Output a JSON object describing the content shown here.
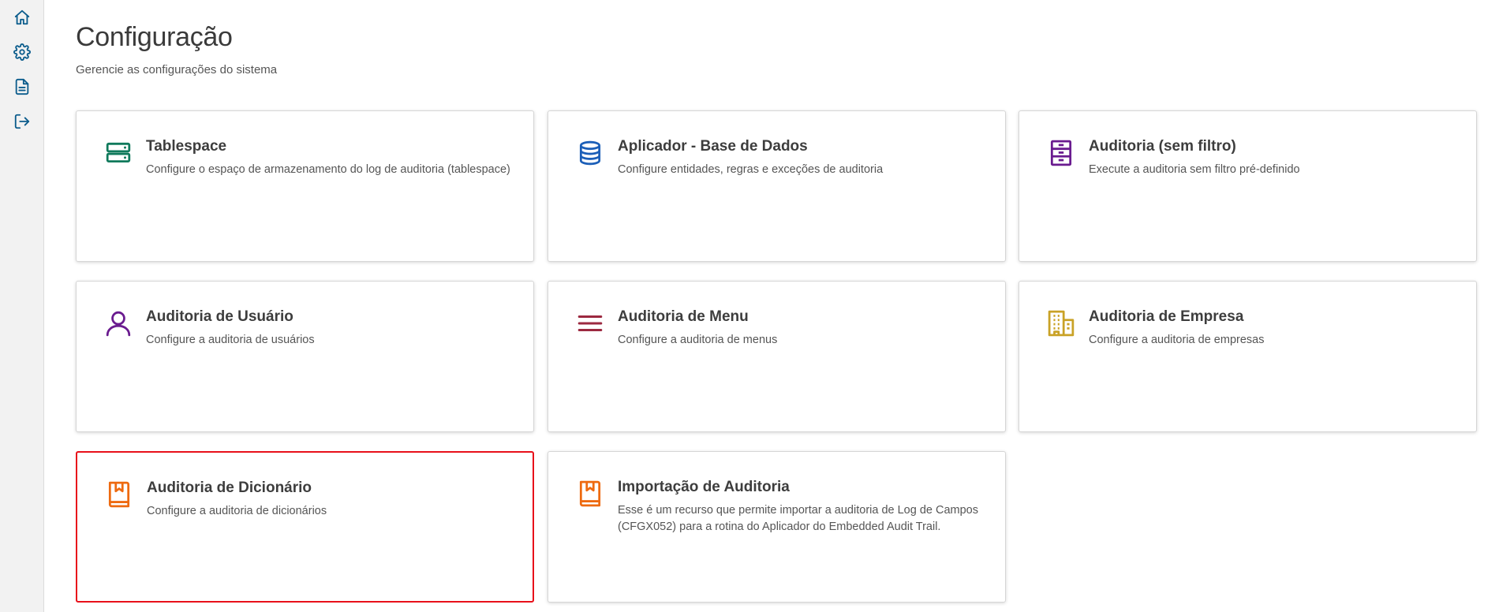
{
  "sidebar": {
    "items": [
      {
        "icon": "home-icon"
      },
      {
        "icon": "gear-icon"
      },
      {
        "icon": "document-icon"
      },
      {
        "icon": "logout-icon"
      }
    ],
    "icon_color": "#0b5c8c"
  },
  "header": {
    "title": "Configuração",
    "subtitle": "Gerencie as configurações do sistema"
  },
  "cards": [
    {
      "title": "Tablespace",
      "description": "Configure o espaço de armazenamento do log de auditoria (tablespace)",
      "icon": "server-icon",
      "color": "#107a5c"
    },
    {
      "title": "Aplicador - Base de Dados",
      "description": "Configure entidades, regras e exceções de auditoria",
      "icon": "database-icon",
      "color": "#1c5fb8"
    },
    {
      "title": "Auditoria (sem filtro)",
      "description": "Execute a auditoria sem filtro pré-definido",
      "icon": "file-cabinet-icon",
      "color": "#6a1b8f"
    },
    {
      "title": "Auditoria de Usuário",
      "description": "Configure a auditoria de usuários",
      "icon": "user-icon",
      "color": "#6a1b8f"
    },
    {
      "title": "Auditoria de Menu",
      "description": "Configure a auditoria de menus",
      "icon": "menu-icon",
      "color": "#9c2940"
    },
    {
      "title": "Auditoria de Empresa",
      "description": "Configure a auditoria de empresas",
      "icon": "building-icon",
      "color": "#c9a227"
    },
    {
      "title": "Auditoria de Dicionário",
      "description": "Configure a auditoria de dicionários",
      "icon": "book-icon",
      "color": "#ee6a10"
    },
    {
      "title": "Importação de Auditoria",
      "description": "Esse é um recurso que permite importar a auditoria de Log de Campos (CFGX052) para a rotina do Aplicador do Embedded Audit Trail.",
      "icon": "book-icon",
      "color": "#ee6a10"
    }
  ],
  "selected_card_border": "#e8101a"
}
